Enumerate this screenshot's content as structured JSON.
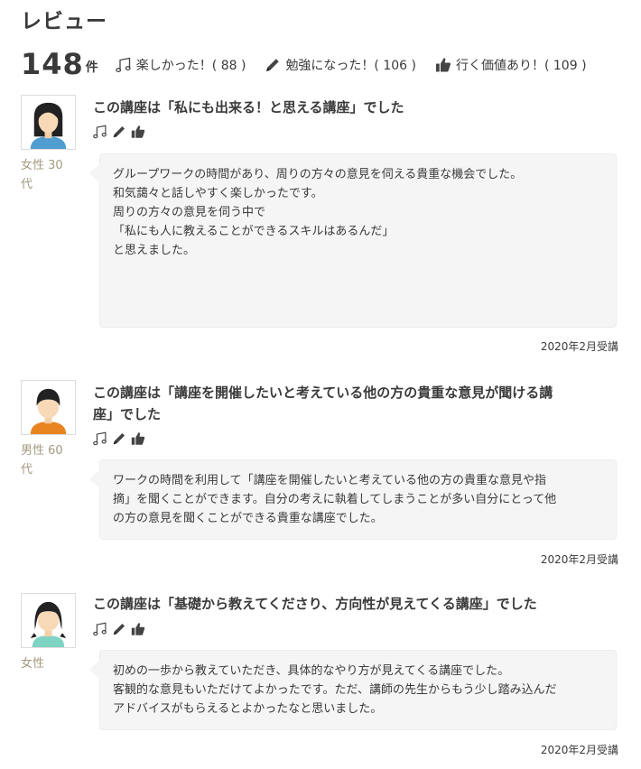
{
  "page": {
    "title": "レビュー"
  },
  "summary": {
    "count": "148",
    "count_unit": "件",
    "fun": "楽しかった！( 88 )",
    "study": "勉強になった！( 106 )",
    "worth": "行く価値あり！( 109 )"
  },
  "reviews": [
    {
      "gender": "女性",
      "age": "30代",
      "title": "この講座は「私にも出来る！と思える講座」でした",
      "body": [
        "グループワークの時間があり、周りの方々の意見を伺える貴重な機会でした。",
        "和気藹々と話しやすく楽しかったです。",
        "周りの方々の意見を伺う中で",
        "「私にも人に教えることができるスキルはあるんだ」",
        "と思えました。"
      ],
      "date": "2020年2月受講"
    },
    {
      "gender": "男性",
      "age": "60代",
      "title_line1": "この講座は「講座を開催したいと考えている他の方の貴重な意見が聞ける講",
      "title_line2": "座」でした",
      "body": [
        "ワークの時間を利用して「講座を開催したいと考えている他の方の貴重な意見や指",
        "摘」を聞くことができます。自分の考えに執着してしまうことが多い自分にとって他",
        "の方の意見を聞くことができる貴重な講座でした。"
      ],
      "date": "2020年2月受講"
    },
    {
      "gender": "女性",
      "title": "この講座は「基礎から教えてくださり、方向性が見えてくる講座」でした",
      "body": [
        "初めの一歩から教えていただき、具体的なやり方が見えてくる講座でした。",
        "客観的な意見もいただけてよかったです。ただ、講師の先生からもう少し踏み込んだ",
        "アドバイスがもらえるとよかったなと思いました。"
      ],
      "date": "2020年2月受講"
    }
  ],
  "icons": {
    "fun": "music-note-icon",
    "study": "pencil-icon",
    "worth": "thumbs-up-icon"
  }
}
